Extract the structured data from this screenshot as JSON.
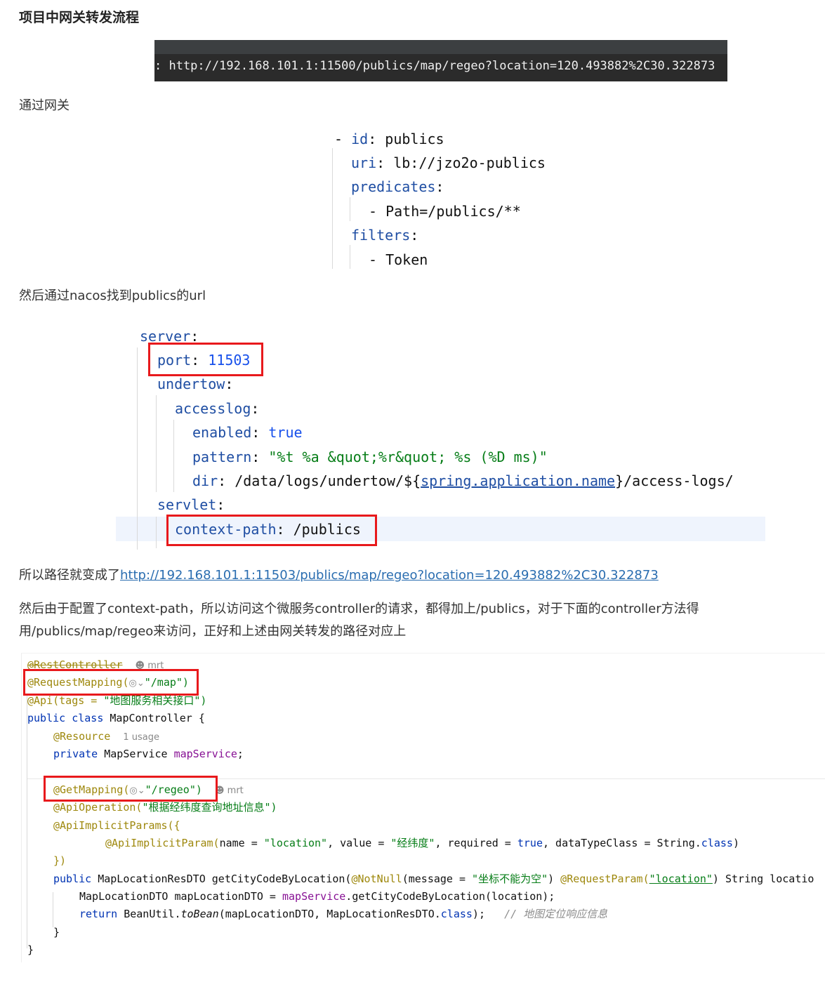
{
  "title": "项目中网关转发流程",
  "url_image_text": ": http://192.168.101.1:11500/publics/map/regeo?location=120.493882%2C30.322873",
  "p1": "通过网关",
  "gateway_yaml": {
    "dash": "-",
    "id_key": "id",
    "id_val": "publics",
    "uri_key": "uri",
    "uri_val": "lb://jzo2o-publics",
    "predicates_key": "predicates",
    "path_item": "- Path=/publics/**",
    "filters_key": "filters",
    "token_item": "- Token"
  },
  "p2": "然后通过nacos找到publics的url",
  "server_yaml": {
    "server_key": "server",
    "port_key": "port",
    "port_val": "11503",
    "undertow_key": "undertow",
    "accesslog_key": "accesslog",
    "enabled_key": "enabled",
    "enabled_val": "true",
    "pattern_key": "pattern",
    "pattern_val": "\"%t %a &quot;%r&quot; %s (%D ms)\"",
    "dir_key": "dir",
    "dir_prefix": "/data/logs/undertow/${",
    "dir_link": "spring.application.name",
    "dir_suffix": "}/access-logs/",
    "servlet_key": "servlet",
    "context_key": "context-path",
    "context_val": "/publics"
  },
  "p3_prefix": "所以路径就变成了",
  "p3_link": "http://192.168.101.1:11503/publics/map/regeo?location=120.493882%2C30.322873",
  "p4_line1": "然后由于配置了context-path，所以访问这个微服务controller的请求，都得加上/publics，对于下面的controller方法得",
  "p4_line2": "用/publics/map/regeo来访问，正好和上述由网关转发的路径对应上",
  "java": {
    "rest_controller": "@RestController",
    "author": "mrt",
    "request_mapping_pre": "@RequestMapping(",
    "request_mapping_val": "\"/map\")",
    "api_pre": "@Api(tags = ",
    "api_val": "\"地图服务相关接口\")",
    "class_decl_kw": "public class ",
    "class_decl_name": "MapController {",
    "resource": "@Resource",
    "usage": "1 usage",
    "field_kw": "private ",
    "field_type": "MapService ",
    "field_name": "mapService",
    "semicolon": ";",
    "getmapping_pre": "@GetMapping(",
    "getmapping_val": "\"/regeo\")",
    "author2": "mrt",
    "apiop_pre": "@ApiOperation(",
    "apiop_val": "\"根据经纬度查询地址信息\")",
    "implicit_params": "@ApiImplicitParams({",
    "implicit_param_pre": "@ApiImplicitParam(",
    "implicit_param_a": "name = ",
    "implicit_param_b": "\"location\"",
    "implicit_param_c": ", value = ",
    "implicit_param_d": "\"经纬度\"",
    "implicit_param_e": ", required = ",
    "implicit_param_f": "true",
    "implicit_param_g": ", dataTypeClass = String.",
    "implicit_param_h": "class",
    "implicit_param_i": ")",
    "close_params": "})",
    "method_kw": "public ",
    "method_sig1": "MapLocationResDTO getCityCodeByLocation(",
    "method_notnull": "@NotNull",
    "method_sig2": "(message = ",
    "method_msg": "\"坐标不能为空\"",
    "method_sig3": ") ",
    "method_reqparam": "@RequestParam(",
    "method_rp_val": "\"location\"",
    "method_sig4": ") String locatio",
    "line_dto_a": "MapLocationDTO mapLocationDTO = ",
    "line_dto_b": "mapService",
    "line_dto_c": ".getCityCodeByLocation(location);",
    "ret_kw": "return ",
    "ret_a": "BeanUtil.",
    "ret_b": "toBean",
    "ret_c": "(mapLocationDTO, MapLocationResDTO.",
    "ret_d": "class",
    "ret_e": ");",
    "ret_comment": "// 地图定位响应信息",
    "close_method": "}",
    "close_class": "}"
  }
}
